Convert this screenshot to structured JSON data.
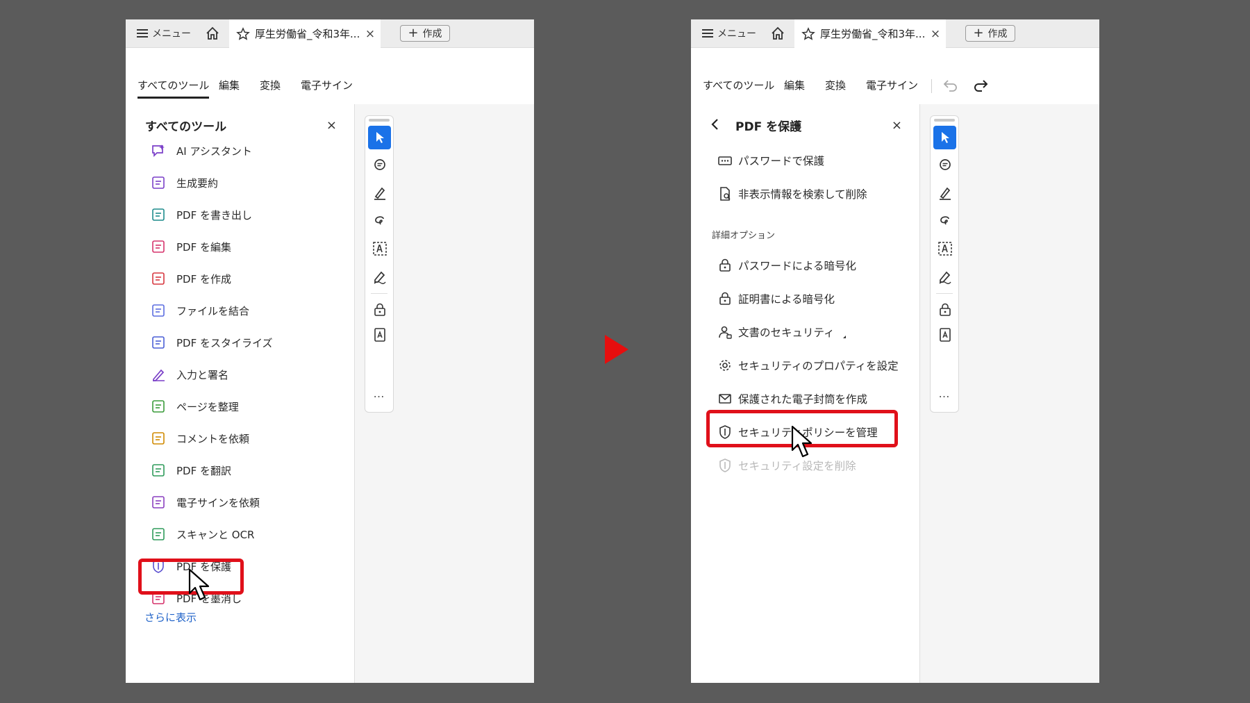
{
  "colors": {
    "accent": "#1a72e8",
    "highlight": "#e0101a",
    "link": "#1f62c8",
    "arrow": "#e60e0e"
  },
  "tabbar": {
    "menu_label": "メニュー",
    "doc_title": "厚生労働省_令和3年...",
    "close_glyph": "×",
    "create_label": "作成",
    "create_glyph": "+"
  },
  "menubar": {
    "items": [
      "すべてのツール",
      "編集",
      "変換",
      "電子サイン"
    ]
  },
  "left_panel": {
    "title": "すべてのツール",
    "close_glyph": "×",
    "tools": [
      {
        "label": "AI アシスタント",
        "icon": "ai-assistant-icon"
      },
      {
        "label": "生成要約",
        "icon": "generative-summary-icon"
      },
      {
        "label": "PDF を書き出し",
        "icon": "export-pdf-icon"
      },
      {
        "label": "PDF を編集",
        "icon": "edit-pdf-icon"
      },
      {
        "label": "PDF を作成",
        "icon": "create-pdf-icon"
      },
      {
        "label": "ファイルを結合",
        "icon": "combine-files-icon"
      },
      {
        "label": "PDF をスタイライズ",
        "icon": "stylize-pdf-icon"
      },
      {
        "label": "入力と署名",
        "icon": "fill-sign-icon"
      },
      {
        "label": "ページを整理",
        "icon": "organize-pages-icon"
      },
      {
        "label": "コメントを依頼",
        "icon": "request-comments-icon"
      },
      {
        "label": "PDF を翻訳",
        "icon": "translate-pdf-icon"
      },
      {
        "label": "電子サインを依頼",
        "icon": "request-esign-icon"
      },
      {
        "label": "スキャンと OCR",
        "icon": "scan-ocr-icon"
      },
      {
        "label": "PDF を保護",
        "icon": "protect-pdf-icon"
      },
      {
        "label": "PDF を墨消し",
        "icon": "redact-pdf-icon"
      }
    ],
    "more_label": "さらに表示"
  },
  "right_panel": {
    "title": "PDF を保護",
    "close_glyph": "×",
    "main_items": [
      {
        "label": "パスワードで保護",
        "icon": "password-protect-icon"
      },
      {
        "label": "非表示情報を検索して削除",
        "icon": "remove-hidden-info-icon"
      }
    ],
    "advanced_heading": "詳細オプション",
    "advanced_items": [
      {
        "label": "パスワードによる暗号化",
        "icon": "password-encrypt-icon"
      },
      {
        "label": "証明書による暗号化",
        "icon": "certificate-encrypt-icon"
      },
      {
        "label": "文書のセキュリティ",
        "icon": "document-security-icon"
      },
      {
        "label": "セキュリティのプロパティを設定",
        "icon": "security-properties-icon"
      },
      {
        "label": "保護された電子封筒を作成",
        "icon": "secure-envelope-icon"
      },
      {
        "label": "セキュリティポリシーを管理",
        "icon": "manage-policy-icon"
      },
      {
        "label": "セキュリティ設定を削除",
        "icon": "remove-security-icon"
      }
    ]
  },
  "quick_tools": [
    "select-icon",
    "comment-icon",
    "highlight-pen-icon",
    "draw-freeform-icon",
    "text-recognition-icon",
    "sign-icon",
    "protect-icon",
    "export-icon"
  ],
  "quick_more": "…"
}
